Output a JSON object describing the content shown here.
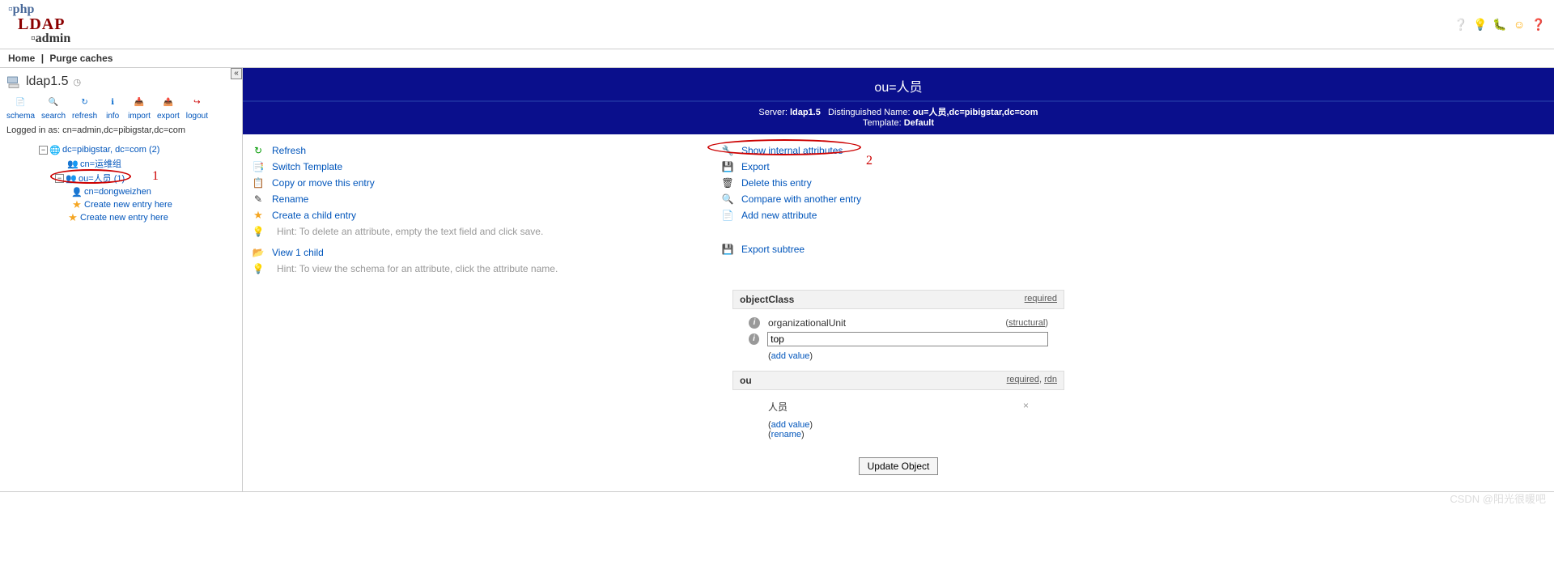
{
  "topbar": {
    "home": "Home",
    "purge": "Purge caches"
  },
  "sidebar": {
    "server": "ldap1.5",
    "toolbar": [
      "schema",
      "search",
      "refresh",
      "info",
      "import",
      "export",
      "logout"
    ],
    "logged_in": "Logged in as: cn=admin,dc=pibigstar,dc=com",
    "tree": {
      "root": "dc=pibigstar, dc=com (2)",
      "n1": "cn=运维组",
      "n2": "ou=人员 (1)",
      "n3": "cn=dongweizhen",
      "create1": "Create new entry here",
      "create2": "Create new entry here"
    },
    "annot1": "1"
  },
  "main": {
    "title": "ou=人员",
    "sub": {
      "server_label": "Server:",
      "server": "ldap1.5",
      "dn_label": "Distinguished Name:",
      "dn": "ou=人员,dc=pibigstar,dc=com",
      "tpl_label": "Template:",
      "tpl": "Default"
    },
    "left_actions": {
      "refresh": "Refresh",
      "switch": "Switch Template",
      "copy": "Copy or move this entry",
      "rename": "Rename",
      "create_child": "Create a child entry",
      "hint1": "Hint: To delete an attribute, empty the text field and click save.",
      "view_child": "View 1 child",
      "hint2": "Hint: To view the schema for an attribute, click the attribute name."
    },
    "right_actions": {
      "show_internal": "Show internal attributes",
      "export": "Export",
      "delete": "Delete this entry",
      "compare": "Compare with another entry",
      "add_attr": "Add new attribute",
      "export_sub": "Export subtree"
    },
    "annot2": "2",
    "attrs": {
      "oc_label": "objectClass",
      "oc_required": "required",
      "oc_v1": "organizationalUnit",
      "oc_v1_flag": "structural",
      "oc_v2": "top",
      "add_value": "add value",
      "ou_label": "ou",
      "ou_flags": "required, rdn",
      "ou_value": "人员",
      "rename": "rename"
    },
    "update_btn": "Update Object"
  },
  "watermark": "CSDN @阳光很暖吧"
}
